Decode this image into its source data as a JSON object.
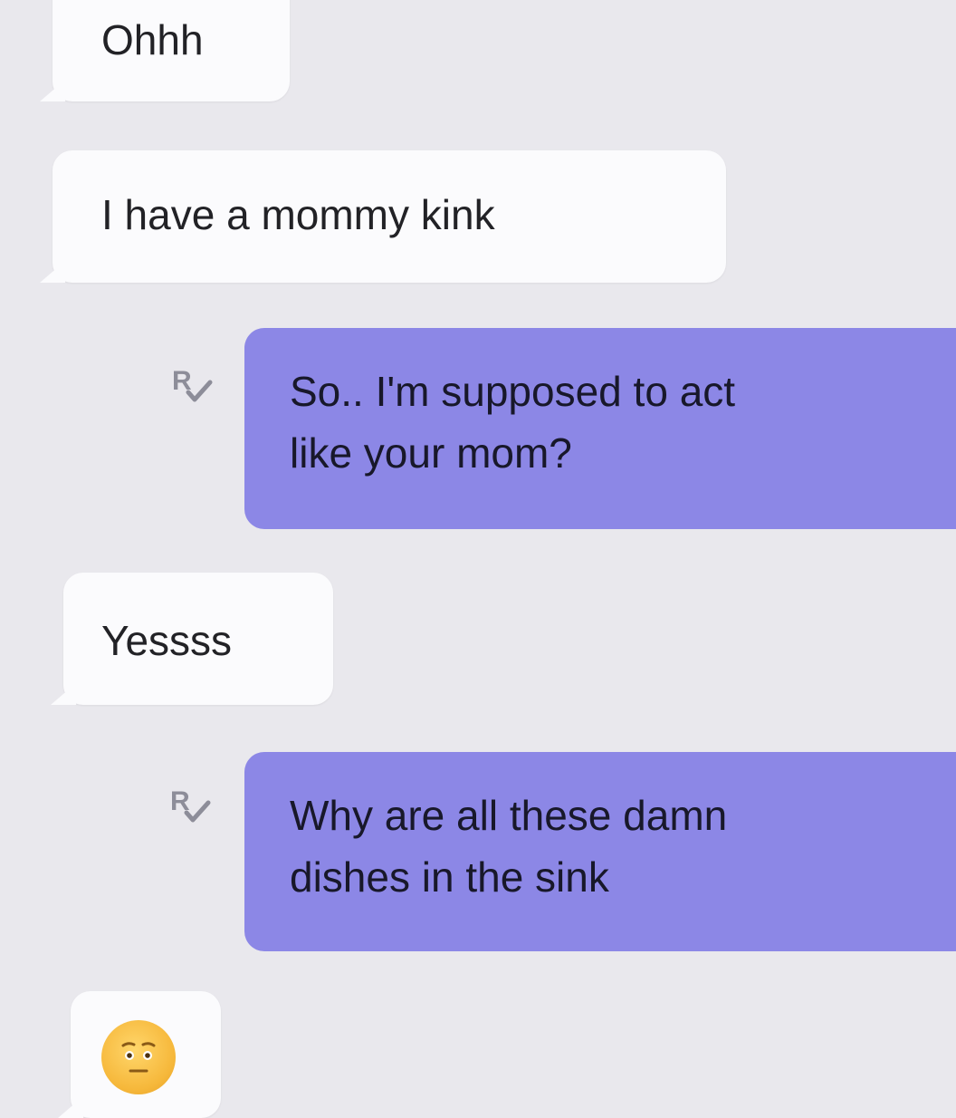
{
  "conversation": {
    "messages": [
      {
        "direction": "incoming",
        "text": "Ohhh"
      },
      {
        "direction": "incoming",
        "text": "I have a mommy kink"
      },
      {
        "direction": "outgoing",
        "text": "So.. I'm supposed to act\nlike your mom?",
        "read_receipt_icon": "read-receipt-r-check-icon"
      },
      {
        "direction": "incoming",
        "text": "Yessss"
      },
      {
        "direction": "outgoing",
        "text": "Why are all these damn\ndishes in the sink",
        "read_receipt_icon": "read-receipt-r-check-icon"
      },
      {
        "direction": "incoming",
        "text": "",
        "icon": "flushed-face-emoji-icon"
      }
    ]
  },
  "colors": {
    "background": "#e9e8ed",
    "incoming_bubble": "#fbfbfd",
    "outgoing_bubble": "#8c87e6",
    "text": "#222226",
    "read_receipt": "#8d8d99"
  }
}
